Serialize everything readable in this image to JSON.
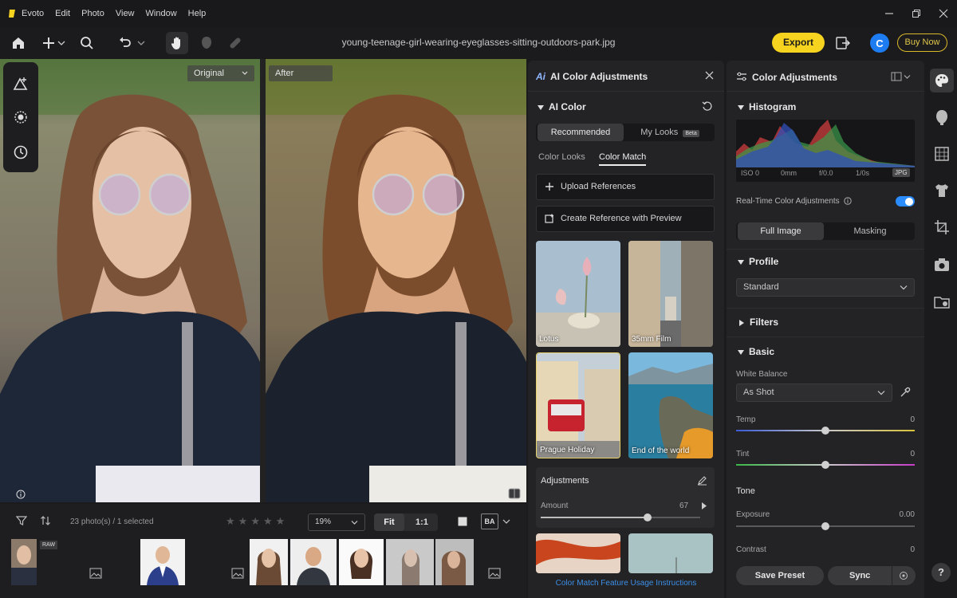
{
  "menubar": {
    "app_name": "Evoto",
    "items": [
      "Edit",
      "Photo",
      "View",
      "Window",
      "Help"
    ]
  },
  "toolbar": {
    "filename": "young-teenage-girl-wearing-eyeglasses-sitting-outdoors-park.jpg",
    "export_label": "Export",
    "avatar_letter": "C",
    "buy_now_label": "Buy Now"
  },
  "viewer": {
    "original_label": "Original",
    "after_label": "After"
  },
  "filmstrip": {
    "count_text": "23 photo(s) / 1 selected",
    "zoom_value": "19%",
    "fit_label": "Fit",
    "one_to_one_label": "1:1",
    "raw_badge": "RAW",
    "rating_stars": 5,
    "ba_label": "BA"
  },
  "ai_panel": {
    "title": "AI Color Adjustments",
    "section_ai_color": "AI Color",
    "tab_recommended": "Recommended",
    "tab_my_looks": "My Looks",
    "beta_badge": "Beta",
    "subtab_color_looks": "Color Looks",
    "subtab_color_match": "Color Match",
    "upload_references": "Upload References",
    "create_reference": "Create Reference with Preview",
    "looks": [
      {
        "name": "Lotus"
      },
      {
        "name": "35mm Film"
      },
      {
        "name": "Prague Holiday"
      },
      {
        "name": "End of the world"
      }
    ],
    "adjustments_title": "Adjustments",
    "amount_label": "Amount",
    "amount_value": "67",
    "amount_fraction": 0.67,
    "footer_link": "Color Match Feature Usage Instructions"
  },
  "color_panel": {
    "title": "Color Adjustments",
    "histogram_title": "Histogram",
    "exif": {
      "iso": "ISO 0",
      "focal": "0mm",
      "aperture": "f/0.0",
      "shutter": "1/0s",
      "format": "JPG"
    },
    "realtime_label": "Real-Time Color Adjustments",
    "realtime_on": true,
    "tab_full_image": "Full Image",
    "tab_masking": "Masking",
    "profile_title": "Profile",
    "profile_value": "Standard",
    "filters_title": "Filters",
    "basic_title": "Basic",
    "white_balance_label": "White Balance",
    "white_balance_value": "As Shot",
    "temp_label": "Temp",
    "temp_value": "0",
    "tint_label": "Tint",
    "tint_value": "0",
    "tone_title": "Tone",
    "exposure_label": "Exposure",
    "exposure_value": "0.00",
    "contrast_label": "Contrast",
    "contrast_value": "0",
    "save_preset": "Save Preset",
    "sync": "Sync"
  },
  "colors": {
    "accent_yellow": "#f6d31e",
    "toggle_blue": "#2b8cff",
    "link_blue": "#3b8fe8"
  }
}
